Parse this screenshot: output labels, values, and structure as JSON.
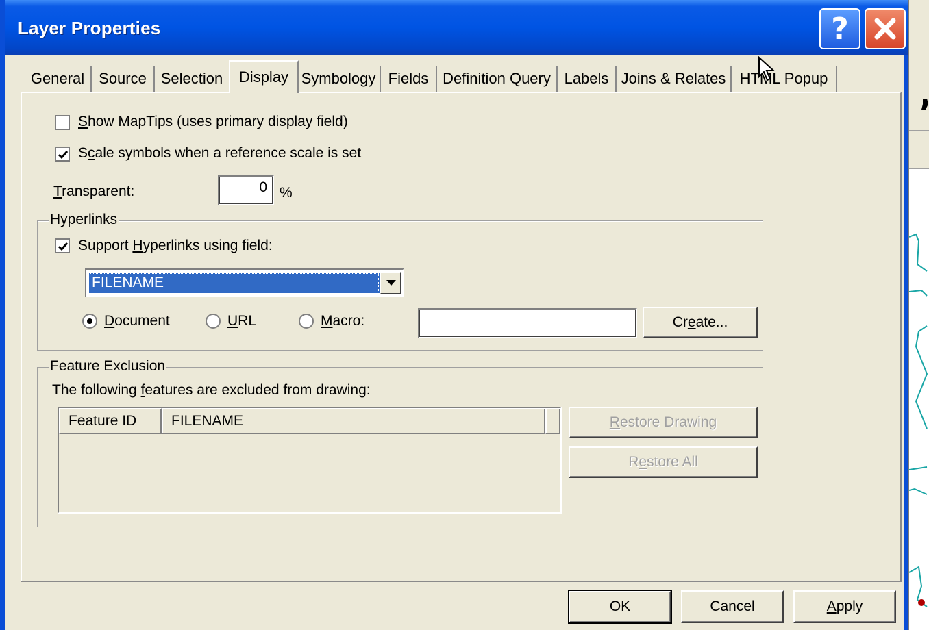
{
  "window": {
    "title": "Layer Properties",
    "help_glyph": "?",
    "icons": [
      "help-icon",
      "close-icon"
    ],
    "colors": {
      "titlebar": "#0054e3",
      "face": "#ece9d8",
      "close": "#d7462a",
      "selection": "#316ac5"
    }
  },
  "tabs": [
    {
      "label": "General"
    },
    {
      "label": "Source"
    },
    {
      "label": "Selection"
    },
    {
      "label": "Display"
    },
    {
      "label": "Symbology"
    },
    {
      "label": "Fields"
    },
    {
      "label": "Definition Query"
    },
    {
      "label": "Labels"
    },
    {
      "label": "Joins & Relates"
    },
    {
      "label": "HTML Popup"
    }
  ],
  "active_tab": "Display",
  "display": {
    "show_maptips": {
      "pre": "",
      "key": "S",
      "post": "how MapTips (uses primary display field)",
      "checked": false
    },
    "scale_symbols": {
      "pre": "S",
      "key": "c",
      "post": "ale symbols when a reference scale is set",
      "checked": true
    },
    "transparent": {
      "pre": "",
      "key": "T",
      "post": "ransparent:",
      "value": "0",
      "unit": "%"
    }
  },
  "hyperlinks": {
    "legend": "Hyperlinks",
    "support": {
      "pre": "Support ",
      "key": "H",
      "post": "yperlinks using field:",
      "checked": true
    },
    "field": "FILENAME",
    "radios": [
      {
        "pre": "",
        "key": "D",
        "post": "ocument",
        "selected": true
      },
      {
        "pre": "",
        "key": "U",
        "post": "RL",
        "selected": false
      },
      {
        "pre": "",
        "key": "M",
        "post": "acro:",
        "selected": false
      }
    ],
    "macro_value": "",
    "create_button": {
      "pre": "Cr",
      "key": "e",
      "post": "ate..."
    }
  },
  "feature_exclusion": {
    "legend": "Feature Exclusion",
    "caption": {
      "pre": "The following ",
      "key": "f",
      "post": "eatures are excluded from drawing:"
    },
    "columns": [
      "Feature ID",
      "FILENAME"
    ],
    "rows": [],
    "restore_drawing": {
      "pre": "",
      "key": "R",
      "post": "estore Drawing"
    },
    "restore_all": {
      "pre": "R",
      "key": "e",
      "post": "store All"
    }
  },
  "footer": {
    "ok": "OK",
    "cancel": "Cancel",
    "apply": {
      "pre": "",
      "key": "A",
      "post": "pply"
    }
  }
}
